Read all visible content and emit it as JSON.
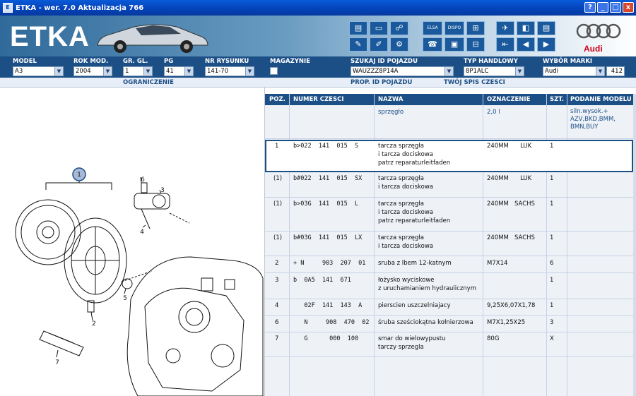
{
  "window": {
    "title": "ETKA - wer. 7.0 Aktualizacja 766",
    "buttons": [
      "?",
      "_",
      "□",
      "x"
    ]
  },
  "brand": {
    "logo_text": "ETKA",
    "make_text": "Audi"
  },
  "toolbar": {
    "icons": [
      "printer-icon",
      "monitor-icon",
      "handshake-icon",
      "notepad-icon",
      "pen-icon",
      "car-network-icon",
      "elsa-icon",
      "dispo-icon",
      "cart-icon",
      "pin-icon",
      "book-icon",
      "page-icon",
      "nav-start-icon",
      "nav-prev-icon",
      "nav-next-icon"
    ],
    "elsa_label": "ELSA",
    "dispo_label": "DISPO"
  },
  "fields": {
    "model": {
      "label": "MODEL",
      "value": "A3"
    },
    "rok": {
      "label": "ROK MOD.",
      "value": "2004"
    },
    "grgl": {
      "label": "GR. GL.",
      "value": "1"
    },
    "pg": {
      "label": "PG",
      "value": "41"
    },
    "nr_rysunku": {
      "label": "NR RYSUNKU",
      "value": "141-70"
    },
    "magazynie": {
      "label": "MAGAZYNIE"
    },
    "szukaj": {
      "label": "SZUKAJ ID POJAZDU",
      "value": "WAUZZZ8P14A"
    },
    "typ": {
      "label": "TYP HANDLOWY",
      "value": "8P1ALC"
    },
    "marka": {
      "label": "WYBÓR MARKI",
      "value": "Audi"
    },
    "counter": "412"
  },
  "sublinks": {
    "ograniczenie": "OGRANICZENIE",
    "prop": "PROP. ID POJAZDU",
    "spis": "TWÓJ SPIS CZESCI"
  },
  "diagram": {
    "callouts": [
      "1",
      "2",
      "3",
      "4",
      "5",
      "6",
      "7"
    ]
  },
  "table": {
    "headers": [
      "POZ.",
      "NUMER CZESCI",
      "NAZWA",
      "OZNACZENIE",
      "SZT.",
      "PODANIE MODELU"
    ],
    "group": {
      "nazwa": "sprzęgło",
      "oznaczenie": "2,0 l",
      "model": "siln.wysok.+\nAZV,BKD,BMM,\nBMN,BUY"
    },
    "rows": [
      {
        "poz": "1",
        "nr": "b>022  141  015  S",
        "nazwa": "tarcza sprzęgła\ni tarcza dociskowa\npatrz reparaturleitfaden",
        "ozn": "240MM      LUK",
        "szt": "1"
      },
      {
        "poz": "(1)",
        "nr": "b#022  141  015  SX",
        "nazwa": "tarcza sprzęgła\ni tarcza dociskowa",
        "ozn": "240MM      LUK",
        "szt": "1"
      },
      {
        "poz": "(1)",
        "nr": "b>03G  141  015  L",
        "nazwa": "tarcza sprzęgła\ni tarcza dociskowa\npatrz reparaturleitfaden",
        "ozn": "240MM   SACHS",
        "szt": "1"
      },
      {
        "poz": "(1)",
        "nr": "b#03G  141  015  LX",
        "nazwa": "tarcza sprzęgła\ni tarcza dociskowa",
        "ozn": "240MM   SACHS",
        "szt": "1"
      },
      {
        "poz": "2",
        "nr": "+ N     903  207  01",
        "nazwa": "sruba z lbem 12-katnym",
        "ozn": "M7X14",
        "szt": "6"
      },
      {
        "poz": "3",
        "nr": "b  0A5  141  671",
        "nazwa": "łożysko wyciskowe\nz uruchamianiem hydraulicznym",
        "ozn": "",
        "szt": "1"
      },
      {
        "poz": "4",
        "nr": "   02F  141  143  A",
        "nazwa": "pierscien uszczelniajacy",
        "ozn": "9,25X6,07X1,78",
        "szt": "1"
      },
      {
        "poz": "6",
        "nr": "   N     908  470  02",
        "nazwa": "śruba sześciokątna kołnierzowa",
        "ozn": "M7X1,25X25",
        "szt": "3"
      },
      {
        "poz": "7",
        "nr": "   G      000  100",
        "nazwa": "smar do wielowypustu\ntarczy sprzegla",
        "ozn": "80G",
        "szt": "X"
      }
    ]
  }
}
